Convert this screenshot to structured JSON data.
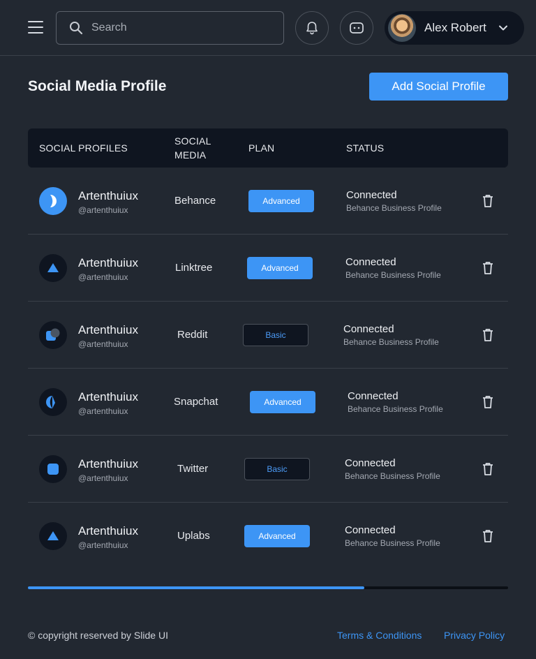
{
  "header": {
    "search_placeholder": "Search",
    "user_name": "Alex Robert"
  },
  "page": {
    "title": "Social Media Profile",
    "add_button": "Add Social Profile"
  },
  "table": {
    "headers": [
      "SOCIAL PROFILES",
      "SOCIAL MEDIA",
      "PLAN",
      "STATUS"
    ],
    "rows": [
      {
        "name": "Artenthuiux",
        "handle": "@artenthuiux",
        "media": "Behance",
        "plan": "Advanced",
        "status": "Connected",
        "status_detail": "Behance Business Profile",
        "icon": "behance-icon"
      },
      {
        "name": "Artenthuiux",
        "handle": "@artenthuiux",
        "media": "Linktree",
        "plan": "Advanced",
        "status": "Connected",
        "status_detail": "Behance Business Profile",
        "icon": "linktree-icon"
      },
      {
        "name": "Artenthuiux",
        "handle": "@artenthuiux",
        "media": "Reddit",
        "plan": "Basic",
        "status": "Connected",
        "status_detail": "Behance Business Profile",
        "icon": "reddit-icon"
      },
      {
        "name": "Artenthuiux",
        "handle": "@artenthuiux",
        "media": "Snapchat",
        "plan": "Advanced",
        "status": "Connected",
        "status_detail": "Behance Business Profile",
        "icon": "snapchat-icon"
      },
      {
        "name": "Artenthuiux",
        "handle": "@artenthuiux",
        "media": "Twitter",
        "plan": "Basic",
        "status": "Connected",
        "status_detail": "Behance Business Profile",
        "icon": "twitter-icon"
      },
      {
        "name": "Artenthuiux",
        "handle": "@artenthuiux",
        "media": "Uplabs",
        "plan": "Advanced",
        "status": "Connected",
        "status_detail": "Behance Business Profile",
        "icon": "uplabs-icon"
      }
    ]
  },
  "scroll": {
    "position_fraction": 0.7
  },
  "footer": {
    "copyright": "© copyright reserved by Slide UI",
    "terms": "Terms & Conditions",
    "privacy": "Privacy Policy"
  },
  "colors": {
    "accent": "#3d95f5",
    "background": "#222831",
    "panel": "#0f1520"
  }
}
